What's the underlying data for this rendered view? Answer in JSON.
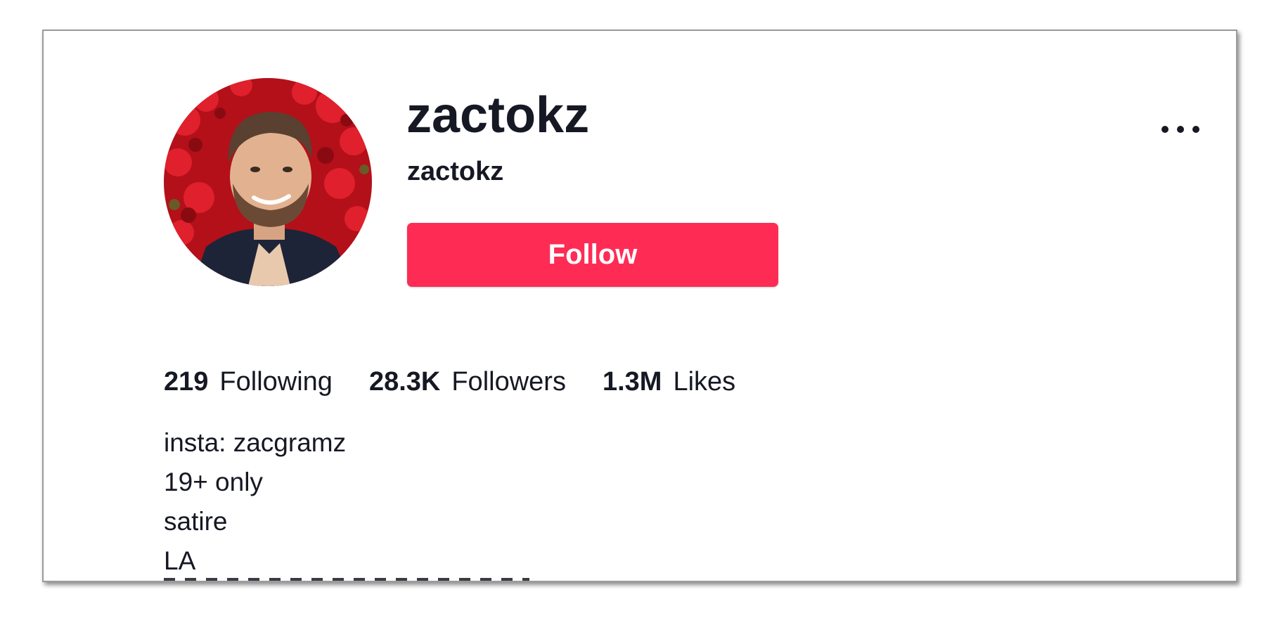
{
  "profile": {
    "display_name": "zactokz",
    "handle": "zactokz",
    "follow_label": "Follow",
    "more_icon": "more-horizontal-icon"
  },
  "stats": [
    {
      "value": "219",
      "label": "Following"
    },
    {
      "value": "28.3K",
      "label": "Followers"
    },
    {
      "value": "1.3M",
      "label": "Likes"
    }
  ],
  "bio": [
    "insta: zacgramz",
    "19+ only",
    "satire",
    "LA"
  ],
  "colors": {
    "accent": "#fe2c55",
    "text": "#161823",
    "background": "#ffffff"
  }
}
